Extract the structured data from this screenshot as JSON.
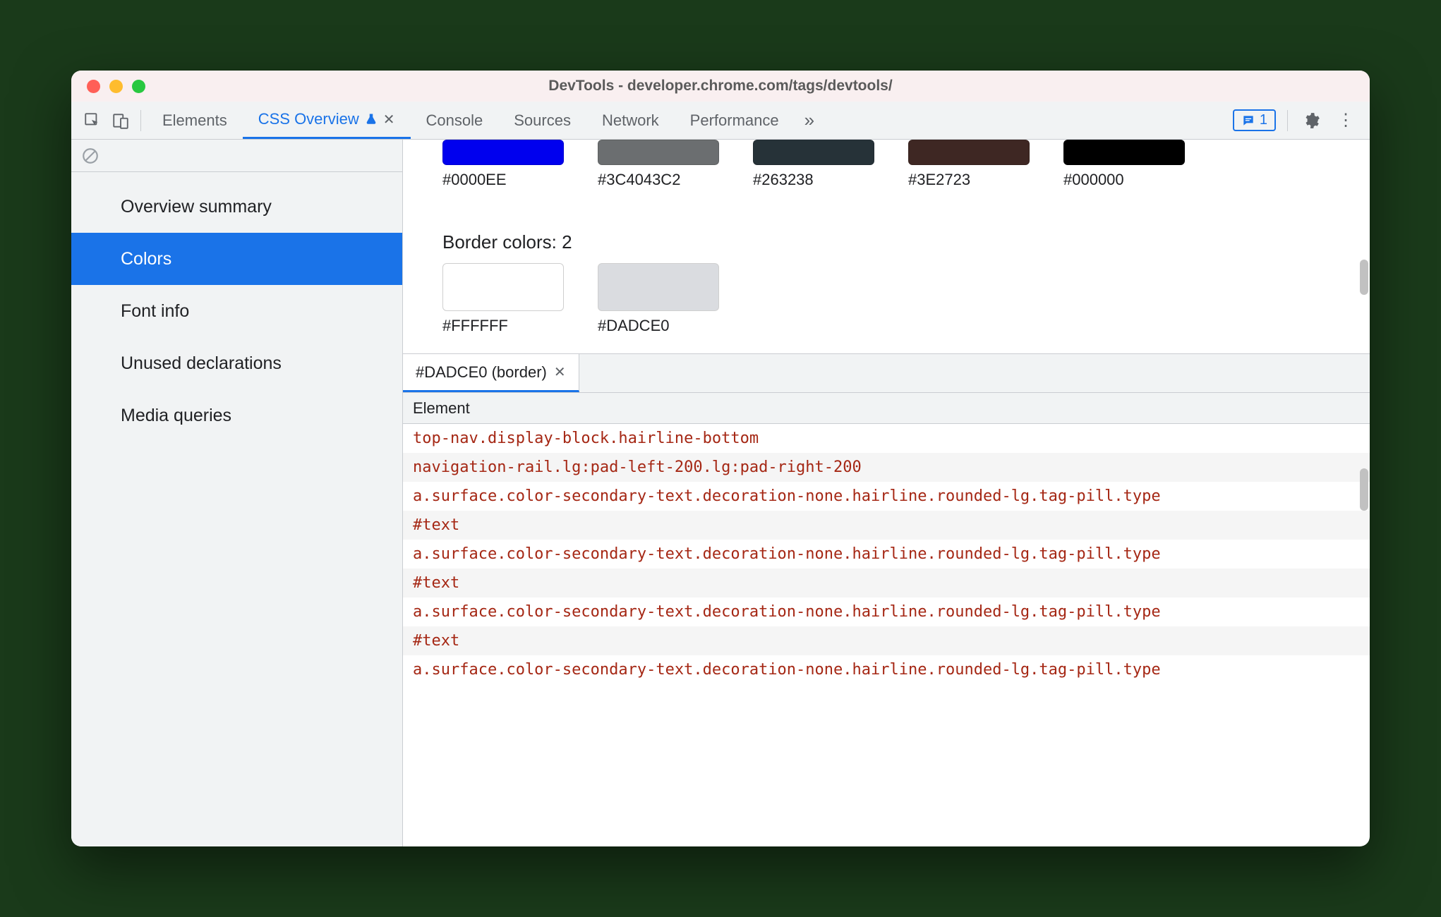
{
  "window": {
    "title": "DevTools - developer.chrome.com/tags/devtools/"
  },
  "tabs": {
    "elements": "Elements",
    "css_overview": "CSS Overview",
    "console": "Console",
    "sources": "Sources",
    "network": "Network",
    "performance": "Performance"
  },
  "msg_count": "1",
  "sidebar": {
    "items": [
      {
        "label": "Overview summary"
      },
      {
        "label": "Colors"
      },
      {
        "label": "Font info"
      },
      {
        "label": "Unused declarations"
      },
      {
        "label": "Media queries"
      }
    ]
  },
  "swatches_top": [
    {
      "hex": "#0000EE",
      "label": "#0000EE"
    },
    {
      "hex": "#3C4043C2",
      "label": "#3C4043C2",
      "css": "rgba(60,64,67,0.76)"
    },
    {
      "hex": "#263238",
      "label": "#263238"
    },
    {
      "hex": "#3E2723",
      "label": "#3E2723"
    },
    {
      "hex": "#000000",
      "label": "#000000"
    }
  ],
  "border_section": {
    "title": "Border colors: 2",
    "swatches": [
      {
        "hex": "#FFFFFF",
        "label": "#FFFFFF"
      },
      {
        "hex": "#DADCE0",
        "label": "#DADCE0"
      }
    ]
  },
  "detail": {
    "tab_label": "#DADCE0 (border)",
    "column_header": "Element",
    "rows": [
      "top-nav.display-block.hairline-bottom",
      "navigation-rail.lg:pad-left-200.lg:pad-right-200",
      "a.surface.color-secondary-text.decoration-none.hairline.rounded-lg.tag-pill.type",
      "#text",
      "a.surface.color-secondary-text.decoration-none.hairline.rounded-lg.tag-pill.type",
      "#text",
      "a.surface.color-secondary-text.decoration-none.hairline.rounded-lg.tag-pill.type",
      "#text",
      "a.surface.color-secondary-text.decoration-none.hairline.rounded-lg.tag-pill.type"
    ]
  }
}
